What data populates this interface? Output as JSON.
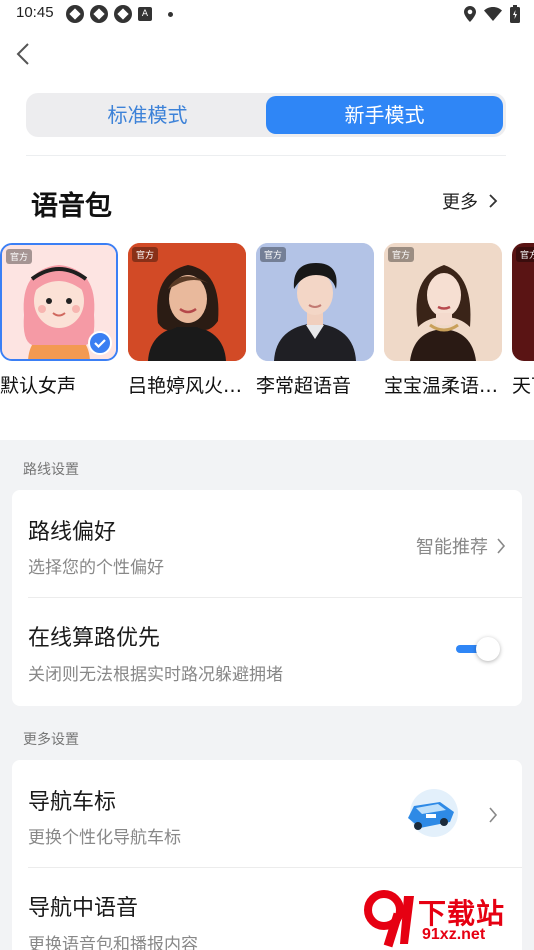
{
  "status_bar": {
    "time": "10:45"
  },
  "mode_toggle": {
    "standard_label": "标准模式",
    "novice_label": "新手模式",
    "selected": "新手模式"
  },
  "voice_packs": {
    "title": "语音包",
    "more_label": "更多",
    "items": [
      {
        "name": "默认女声",
        "tag": "官方",
        "selected": true
      },
      {
        "name": "吕艳婷风火…",
        "tag": "官方",
        "selected": false
      },
      {
        "name": "李常超语音",
        "tag": "官方",
        "selected": false
      },
      {
        "name": "宝宝温柔语…",
        "tag": "官方",
        "selected": false
      },
      {
        "name": "天下",
        "tag": "官方",
        "selected": false
      }
    ]
  },
  "route_settings": {
    "section_label": "路线设置",
    "preference": {
      "title": "路线偏好",
      "subtitle": "选择您的个性偏好",
      "value": "智能推荐"
    },
    "online_routing": {
      "title": "在线算路优先",
      "subtitle": "关闭则无法根据实时路况躲避拥堵",
      "enabled": true
    }
  },
  "more_settings": {
    "section_label": "更多设置",
    "car_icon": {
      "title": "导航车标",
      "subtitle": "更换个性化导航车标"
    },
    "nav_voice": {
      "title": "导航中语音",
      "subtitle": "更换语音包和播报内容"
    }
  },
  "watermark": {
    "brand": "下载站",
    "url": "91xz.net",
    "logo_text": "9"
  },
  "colors": {
    "accent": "#2f86f6",
    "watermark": "#e60012"
  }
}
